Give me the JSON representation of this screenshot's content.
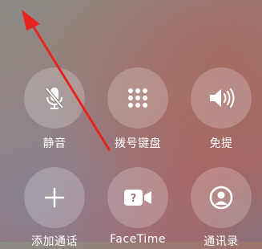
{
  "controls": [
    {
      "key": "mute",
      "label": "静音",
      "icon": "mic-slash-icon"
    },
    {
      "key": "keypad",
      "label": "拨号键盘",
      "icon": "keypad-icon"
    },
    {
      "key": "speaker",
      "label": "免提",
      "icon": "speaker-icon"
    },
    {
      "key": "add-call",
      "label": "添加通话",
      "icon": "plus-icon"
    },
    {
      "key": "facetime",
      "label": "FaceTime",
      "icon": "facetime-icon"
    },
    {
      "key": "contacts",
      "label": "通讯录",
      "icon": "contact-icon"
    }
  ],
  "annotation": {
    "color": "#e8231f",
    "icon": "red-arrow-icon"
  }
}
